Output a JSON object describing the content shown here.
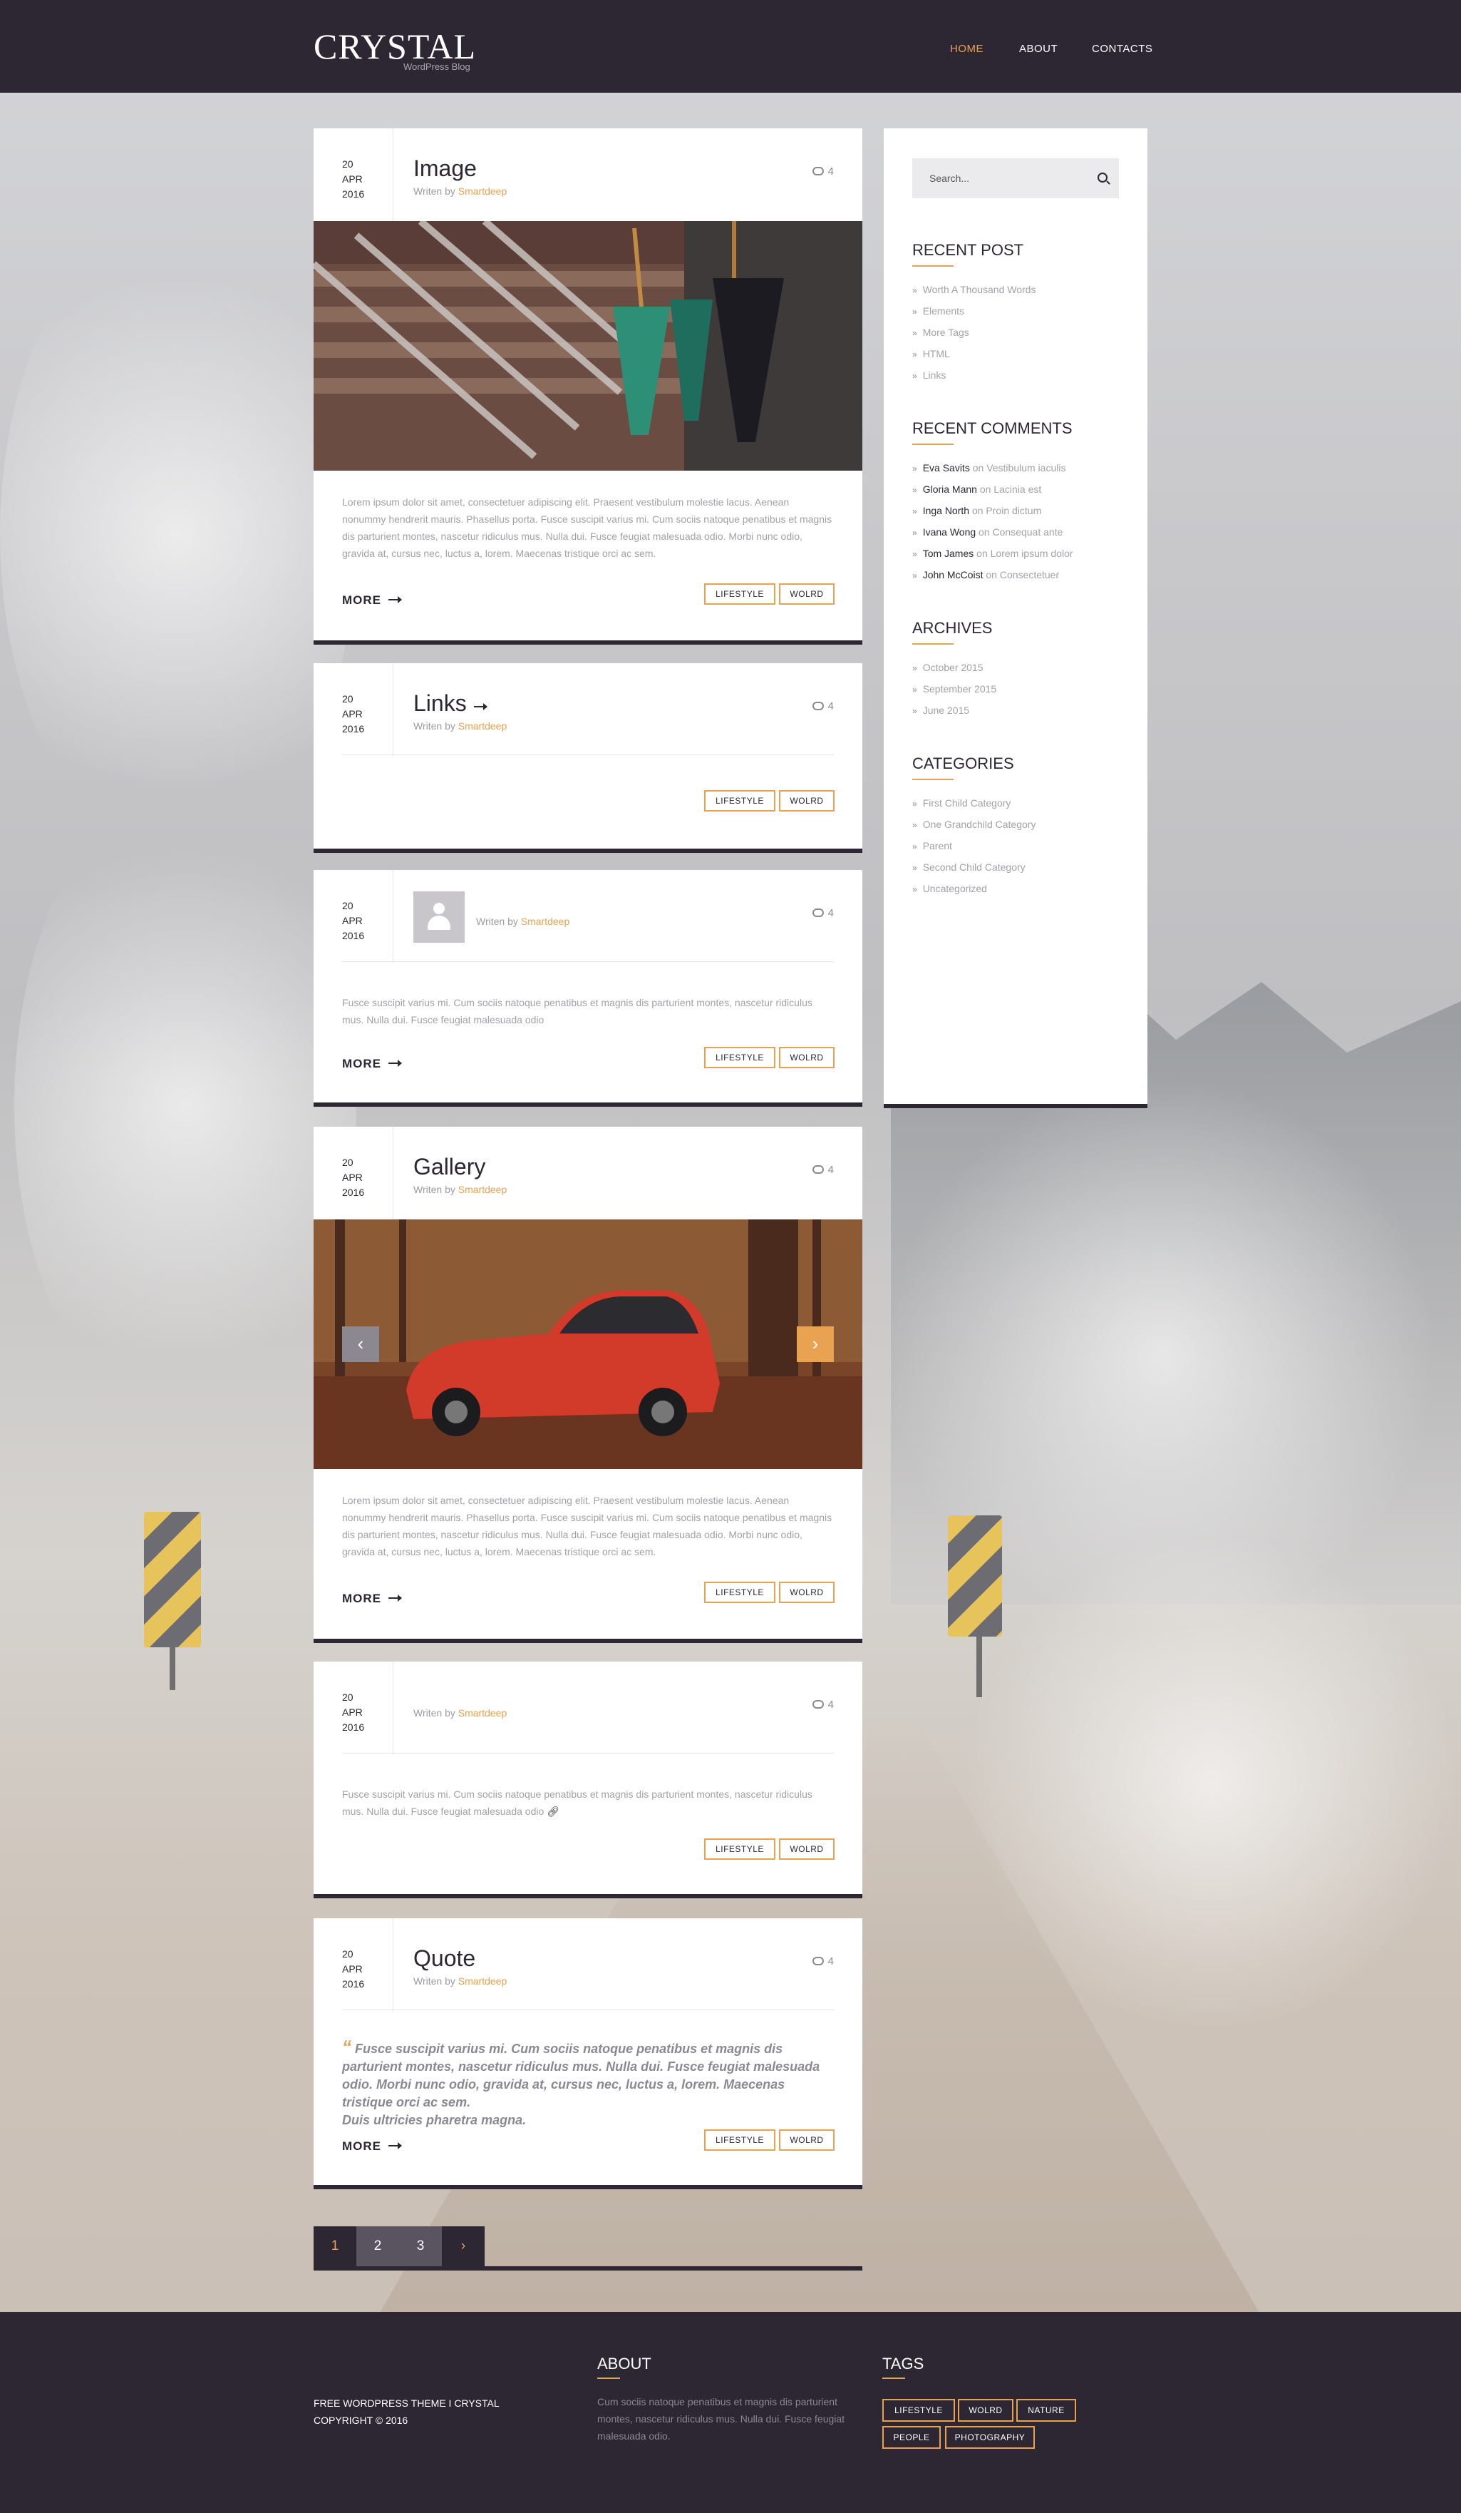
{
  "brand": {
    "logo": "CRYSTAL",
    "tagline": "WordPress Blog",
    "accent": "#e9a252",
    "dark": "#2d2734"
  },
  "nav": [
    {
      "label": "HOME",
      "active": true
    },
    {
      "label": "ABOUT"
    },
    {
      "label": "CONTACTS"
    }
  ],
  "posts": [
    {
      "day": "20",
      "month": "APR",
      "year": "2016",
      "title": "Image",
      "by": "Writen by",
      "author": "Smartdeep",
      "comments": "4",
      "excerpt": "Lorem ipsum dolor sit amet, consectetuer adipiscing elit. Praesent vestibulum molestie lacus. Aenean nonummy hendrerit mauris. Phasellus porta. Fusce suscipit varius mi. Cum sociis natoque penatibus et magnis dis parturient montes, nascetur ridiculus mus. Nulla dui. Fusce feugiat malesuada odio. Morbi nunc odio, gravida at, cursus nec, luctus a, lorem. Maecenas tristique orci ac sem.",
      "more": "MORE",
      "tags": [
        "LIFESTYLE",
        "WOLRD"
      ]
    },
    {
      "day": "20",
      "month": "APR",
      "year": "2016",
      "title": "Links",
      "by": "Writen by",
      "author": "Smartdeep",
      "comments": "4",
      "tags": [
        "LIFESTYLE",
        "WOLRD"
      ]
    },
    {
      "day": "20",
      "month": "APR",
      "year": "2016",
      "by": "Writen by",
      "author": "Smartdeep",
      "comments": "4",
      "excerpt": "Fusce suscipit varius mi. Cum sociis natoque penatibus et magnis dis parturient montes, nascetur ridiculus mus. Nulla dui. Fusce feugiat malesuada odio",
      "more": "MORE",
      "tags": [
        "LIFESTYLE",
        "WOLRD"
      ]
    },
    {
      "day": "20",
      "month": "APR",
      "year": "2016",
      "title": "Gallery",
      "by": "Writen by",
      "author": "Smartdeep",
      "comments": "4",
      "excerpt": "Lorem ipsum dolor sit amet, consectetuer adipiscing elit. Praesent vestibulum molestie lacus. Aenean nonummy hendrerit mauris. Phasellus porta. Fusce suscipit varius mi. Cum sociis natoque penatibus et magnis dis parturient montes, nascetur ridiculus mus. Nulla dui. Fusce feugiat malesuada odio. Morbi nunc odio, gravida at, cursus nec, luctus a, lorem. Maecenas tristique orci ac sem.",
      "more": "MORE",
      "tags": [
        "LIFESTYLE",
        "WOLRD"
      ],
      "prev": "‹",
      "next": "›"
    },
    {
      "day": "20",
      "month": "APR",
      "year": "2016",
      "by": "Writen by",
      "author": "Smartdeep",
      "comments": "4",
      "excerpt": "Fusce suscipit varius mi. Cum sociis natoque penatibus et magnis dis parturient montes, nascetur ridiculus mus. Nulla dui. Fusce feugiat malesuada odio",
      "tags": [
        "LIFESTYLE",
        "WOLRD"
      ]
    },
    {
      "day": "20",
      "month": "APR",
      "year": "2016",
      "title": "Quote",
      "by": "Writen by",
      "author": "Smartdeep",
      "comments": "4",
      "quote_mark": "“",
      "quote": "Fusce suscipit varius mi. Cum sociis natoque penatibus et magnis dis parturient montes, nascetur ridiculus mus. Nulla dui. Fusce feugiat malesuada odio. Morbi nunc odio, gravida at, cursus nec, luctus a, lorem. Maecenas tristique orci ac sem.",
      "quote_tail": "Duis ultricies pharetra magna.",
      "more": "MORE",
      "tags": [
        "LIFESTYLE",
        "WOLRD"
      ]
    }
  ],
  "pagination": [
    "1",
    "2",
    "3",
    "›"
  ],
  "sidebar": {
    "search_placeholder": "Search...",
    "recent_post_title": "RECENT POST",
    "recent_posts": [
      "Worth A Thousand Words",
      "Elements",
      "More Tags",
      "HTML",
      "Links"
    ],
    "recent_comments_title": "RECENT COMMENTS",
    "recent_comments": [
      {
        "name": "Eva Savits",
        "on": "on",
        "post": "Vestibulum iaculis"
      },
      {
        "name": "Gloria Mann",
        "on": "on",
        "post": "Lacinia est"
      },
      {
        "name": "Inga North",
        "on": "on",
        "post": "Proin dictum"
      },
      {
        "name": "Ivana Wong",
        "on": "on",
        "post": "Consequat ante"
      },
      {
        "name": "Tom James",
        "on": "on",
        "post": "Lorem ipsum dolor"
      },
      {
        "name": "John McCoist",
        "on": "on",
        "post": "Consectetuer"
      }
    ],
    "archives_title": "ARCHIVES",
    "archives": [
      "October 2015",
      "September 2015",
      "June 2015"
    ],
    "categories_title": "CATEGORIES",
    "categories": [
      "First Child Category",
      "One Grandchild Category",
      "Parent",
      "Second Child Category",
      "Uncategorized"
    ]
  },
  "footer": {
    "copyright_line1": "FREE WORDPRESS THEME I CRYSTAL",
    "copyright_line2": "COPYRIGHT © 2016",
    "about_title": "ABOUT",
    "about_text": "Cum sociis natoque penatibus et magnis dis parturient montes, nascetur ridiculus mus. Nulla dui. Fusce feugiat malesuada odio.",
    "tags_title": "TAGS",
    "tags": [
      "LIFESTYLE",
      "WOLRD",
      "NATURE",
      "PEOPLE",
      "PHOTOGRAPHY"
    ]
  }
}
